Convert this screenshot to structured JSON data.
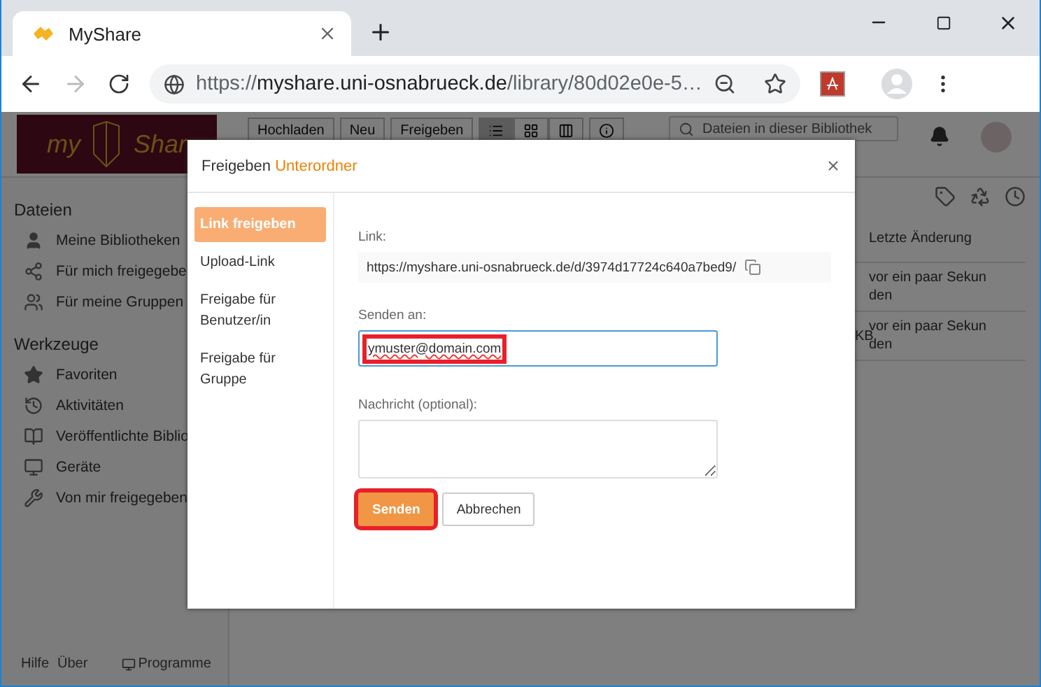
{
  "browser": {
    "tab_title": "MyShare",
    "url_scheme": "https://",
    "url_host": "myshare.uni-osnabrueck.de",
    "url_path": "/library/80d02e0e-5…"
  },
  "app": {
    "logo": {
      "left": "my",
      "right": "Shar"
    },
    "toolbar": [
      "Hochladen",
      "Neu",
      "Freigeben"
    ],
    "views": [
      {
        "kind": "list",
        "selected": true
      },
      {
        "kind": "grid",
        "selected": false
      },
      {
        "kind": "columns",
        "selected": false
      }
    ],
    "search": {
      "placeholder": "Dateien in dieser Bibliothek"
    },
    "sidebar": [
      {
        "heading": "Dateien",
        "items": [
          {
            "label": "Meine Bibliotheken"
          },
          {
            "label": "Für mich freigegebe"
          },
          {
            "label": "Für meine Gruppen"
          }
        ]
      },
      {
        "heading": "Werkzeuge",
        "items": [
          {
            "label": "Favoriten"
          },
          {
            "label": "Aktivitäten"
          },
          {
            "label": "Veröffentlichte Biblio"
          },
          {
            "label": "Geräte"
          },
          {
            "label": "Von mir freigegeben"
          }
        ]
      }
    ],
    "footer": {
      "help": "Hilfe",
      "about": "Über",
      "programs": "Programme"
    },
    "table": {
      "column_header": "Letzte Änderung",
      "rows": [
        {
          "size": "",
          "modified": "vor ein paar Sekunden"
        },
        {
          "size": "KB",
          "modified": "vor ein paar Sekunden"
        }
      ]
    }
  },
  "dialog": {
    "title": "Freigeben",
    "object": "Unterordner",
    "nav": [
      {
        "label": "Link freigeben",
        "selected": true
      },
      {
        "label": "Upload-Link",
        "selected": false
      },
      {
        "label": "Freigabe für Benutzer/in",
        "selected": false
      },
      {
        "label": "Freigabe für Gruppe",
        "selected": false
      }
    ],
    "link": {
      "label": "Link:",
      "value": "https://myshare.uni-osnabrueck.de/d/3974d17724c640a7bed9/"
    },
    "send_to": {
      "label": "Senden an:",
      "value": "ymuster@domain.com",
      "highlighted": true
    },
    "message": {
      "label": "Nachricht (optional):"
    },
    "buttons": [
      {
        "kind": "primary",
        "label": "Senden",
        "highlighted": true
      },
      {
        "kind": "secondary",
        "label": "Abbrechen",
        "highlighted": false
      }
    ]
  }
}
